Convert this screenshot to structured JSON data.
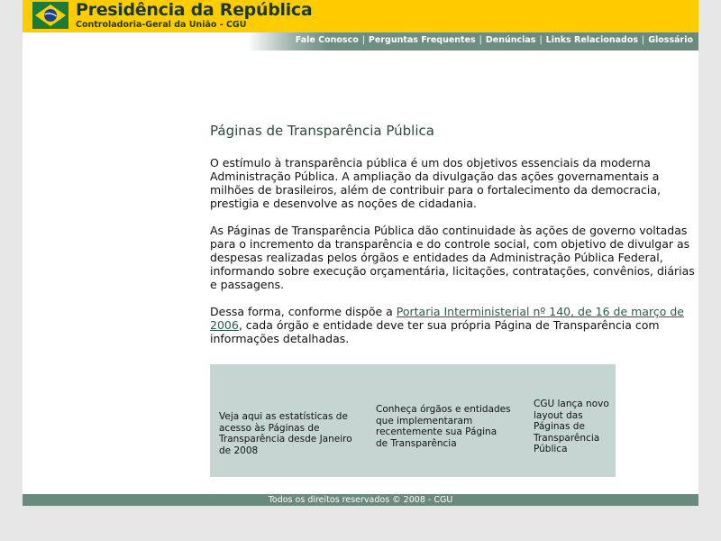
{
  "header": {
    "title": "Presidência da República",
    "subtitle": "Controladoria-Geral da União - CGU",
    "logo_icon": "brazil-flag-icon"
  },
  "nav": {
    "items": [
      {
        "label": "Fale Conosco"
      },
      {
        "label": "Perguntas Frequentes"
      },
      {
        "label": "Denúncias"
      },
      {
        "label": "Links Relacionados"
      },
      {
        "label": "Glossário"
      }
    ],
    "separator": "|"
  },
  "main": {
    "heading": "Páginas de Transparência Pública",
    "paragraph1": "O estímulo à transparência pública é um dos objetivos essenciais da moderna Administração Pública. A ampliação da divulgação das ações governamentais a milhões de brasileiros, além de contribuir para o fortalecimento da democracia, prestigia e desenvolve as noções de cidadania.",
    "paragraph2": "As Páginas de Transparência Pública dão continuidade às ações de governo voltadas para o incremento da transparência e do controle social, com objetivo de divulgar as despesas realizadas pelos órgãos e entidades da Administração Pública Federal, informando sobre execução orçamentária, licitações, contratações, convênios, diárias e passagens.",
    "paragraph3_before": "Dessa forma, conforme dispõe a ",
    "paragraph3_link": "Portaria Interministerial nº 140, de 16 de março de 2006",
    "paragraph3_after": ", cada órgão e entidade deve ter sua própria Página de Transparência com informações detalhadas."
  },
  "boxes": [
    {
      "text": "Veja aqui as estatísticas de acesso às Páginas de Transparência desde Janeiro de 2008"
    },
    {
      "text": "Conheça órgãos e entidades que implementaram recentemente sua Página de Transparência"
    },
    {
      "text": "CGU lança novo layout das Páginas de Transparência Pública"
    }
  ],
  "footer": {
    "text": "Todos os direitos reservados © 2008 - CGU"
  },
  "colors": {
    "header_bg": "#ffcc00",
    "nav_bg": "#6a8a7e",
    "box_bg": "#c5d6d2",
    "page_bg": "#e6e6e6"
  }
}
